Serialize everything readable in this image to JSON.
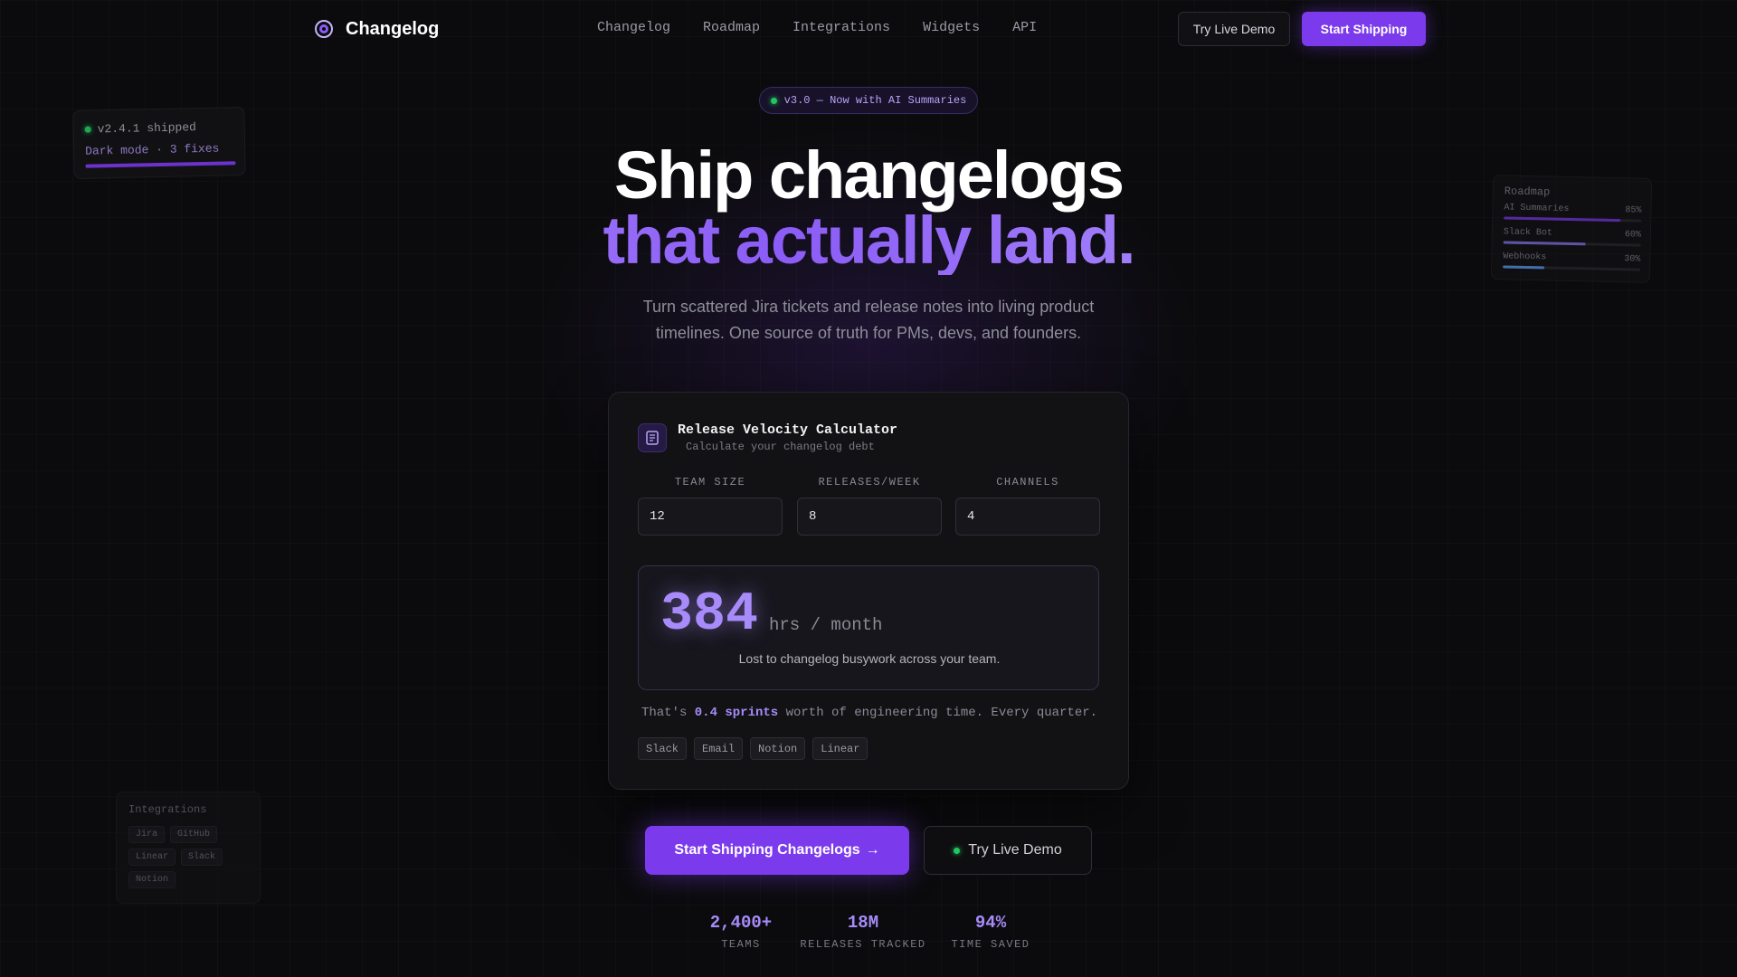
{
  "nav": {
    "brand": "Changelog",
    "links": [
      "Changelog",
      "Roadmap",
      "Integrations",
      "Widgets",
      "API"
    ],
    "demo_label": "Try Live Demo",
    "ship_label": "Start Shipping"
  },
  "badge": {
    "text": "v3.0 — Now with AI Summaries"
  },
  "hero": {
    "line1": "Ship changelogs",
    "line2": "that actually land.",
    "subtitle": "Turn scattered Jira tickets and release notes into living product timelines. One source of truth for PMs, devs, and founders."
  },
  "calculator": {
    "title": "Release Velocity Calculator",
    "subtitle": "Calculate your changelog debt",
    "fields": [
      {
        "label": "TEAM SIZE",
        "value": "12"
      },
      {
        "label": "RELEASES/WEEK",
        "value": "8"
      },
      {
        "label": "CHANNELS",
        "value": "4"
      }
    ],
    "result_value": "384",
    "result_unit": "hrs / month",
    "result_desc": "Lost to changelog busywork across your team.",
    "sprint_prefix": "That's ",
    "sprint_value": "0.4 sprints",
    "sprint_suffix": " worth of engineering time. Every quarter.",
    "chips": [
      "Slack",
      "Email",
      "Notion",
      "Linear"
    ]
  },
  "cta": {
    "primary": "Start Shipping Changelogs",
    "primary_arrow": "→",
    "secondary": "Try Live Demo"
  },
  "stats": [
    {
      "value": "2,400+",
      "label": "TEAMS"
    },
    {
      "value": "18M",
      "label": "RELEASES TRACKED"
    },
    {
      "value": "94%",
      "label": "TIME SAVED"
    }
  ],
  "float_shipped": {
    "line1": "v2.4.1 shipped",
    "line2": "Dark mode · 3 fixes"
  },
  "float_roadmap": {
    "title": "Roadmap",
    "items": [
      {
        "name": "AI Summaries",
        "pct_label": "85%",
        "progress": 0.85,
        "color": "#7c3aed"
      },
      {
        "name": "Slack Bot",
        "pct_label": "60%",
        "progress": 0.6,
        "color": "#8b7cf6"
      },
      {
        "name": "Webhooks",
        "pct_label": "30%",
        "progress": 0.3,
        "color": "#60a5fa"
      }
    ]
  },
  "float_integrations": {
    "title": "Integrations",
    "tags": [
      "Jira",
      "GitHub",
      "Linear",
      "Slack",
      "Notion"
    ]
  },
  "colors": {
    "accent": "#7c3aed",
    "accent_light": "#a78bfa",
    "status_green": "#22c55e"
  }
}
